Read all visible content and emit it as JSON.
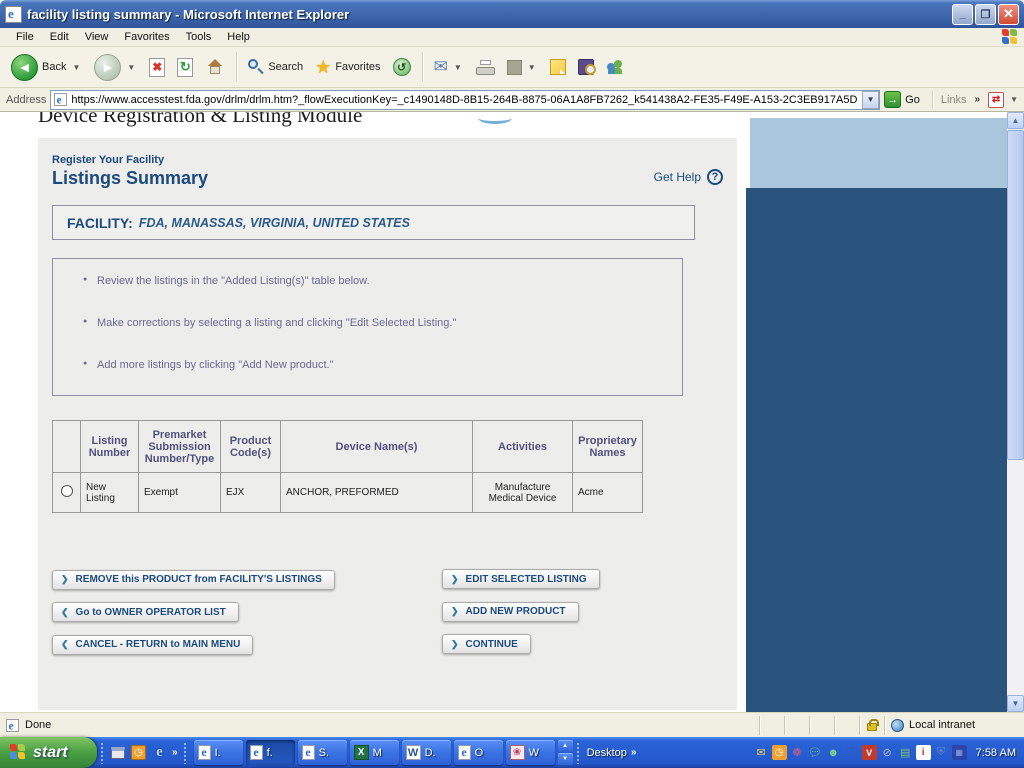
{
  "window": {
    "title": "facility listing summary - Microsoft Internet Explorer",
    "menu": [
      "File",
      "Edit",
      "View",
      "Favorites",
      "Tools",
      "Help"
    ]
  },
  "toolbar": {
    "back": "Back",
    "search": "Search",
    "favorites": "Favorites"
  },
  "address": {
    "label": "Address",
    "url": "https://www.accesstest.fda.gov/drlm/drlm.htm?_flowExecutionKey=_c1490148D-8B15-264B-8875-06A1A8FB7262_k541438A2-FE35-F49E-A153-2C3EB917A5D",
    "go": "Go",
    "links": "Links"
  },
  "page": {
    "module_title": "Device Registration & Listing Module",
    "section_label": "Register Your Facility",
    "page_title": "Listings Summary",
    "get_help": "Get Help",
    "facility_label": "FACILITY:",
    "facility_value": "FDA, MANASSAS, VIRGINIA, UNITED STATES",
    "instructions": [
      "Review the listings in the \"Added Listing(s)\" table below.",
      "Make corrections by selecting a listing and clicking \"Edit Selected Listing.\"",
      "Add more listings by clicking \"Add New product.\""
    ],
    "table": {
      "headers": [
        "Listing Number",
        "Premarket Submission Number/Type",
        "Product Code(s)",
        "Device Name(s)",
        "Activities",
        "Proprietary Names"
      ],
      "row": {
        "cells": [
          "New Listing",
          "Exempt",
          "EJX",
          "ANCHOR, PREFORMED",
          "Manufacture Medical Device",
          "Acme"
        ]
      }
    },
    "buttons": {
      "remove": "REMOVE this PRODUCT from FACILITY'S LISTINGS",
      "owner_operator": "Go to OWNER OPERATOR LIST",
      "cancel": "CANCEL - RETURN to MAIN MENU",
      "edit": "EDIT SELECTED LISTING",
      "add": "ADD NEW PRODUCT",
      "continue": "CONTINUE"
    }
  },
  "status": {
    "done": "Done",
    "zone": "Local intranet"
  },
  "taskbar": {
    "start": "start",
    "tasks": [
      "I.",
      "f.",
      "S.",
      "M",
      "D.",
      "O",
      "W"
    ],
    "desktop": "Desktop",
    "time": "7:58 AM"
  },
  "colors": {
    "accent_navy": "#1b4a7e",
    "instruction_purple": "#6a6a94",
    "sidebar_dark": "#2a547e",
    "sidebar_light": "#a9c6dd",
    "taskbar_blue": "#2a63d6",
    "start_green": "#4ca344"
  }
}
